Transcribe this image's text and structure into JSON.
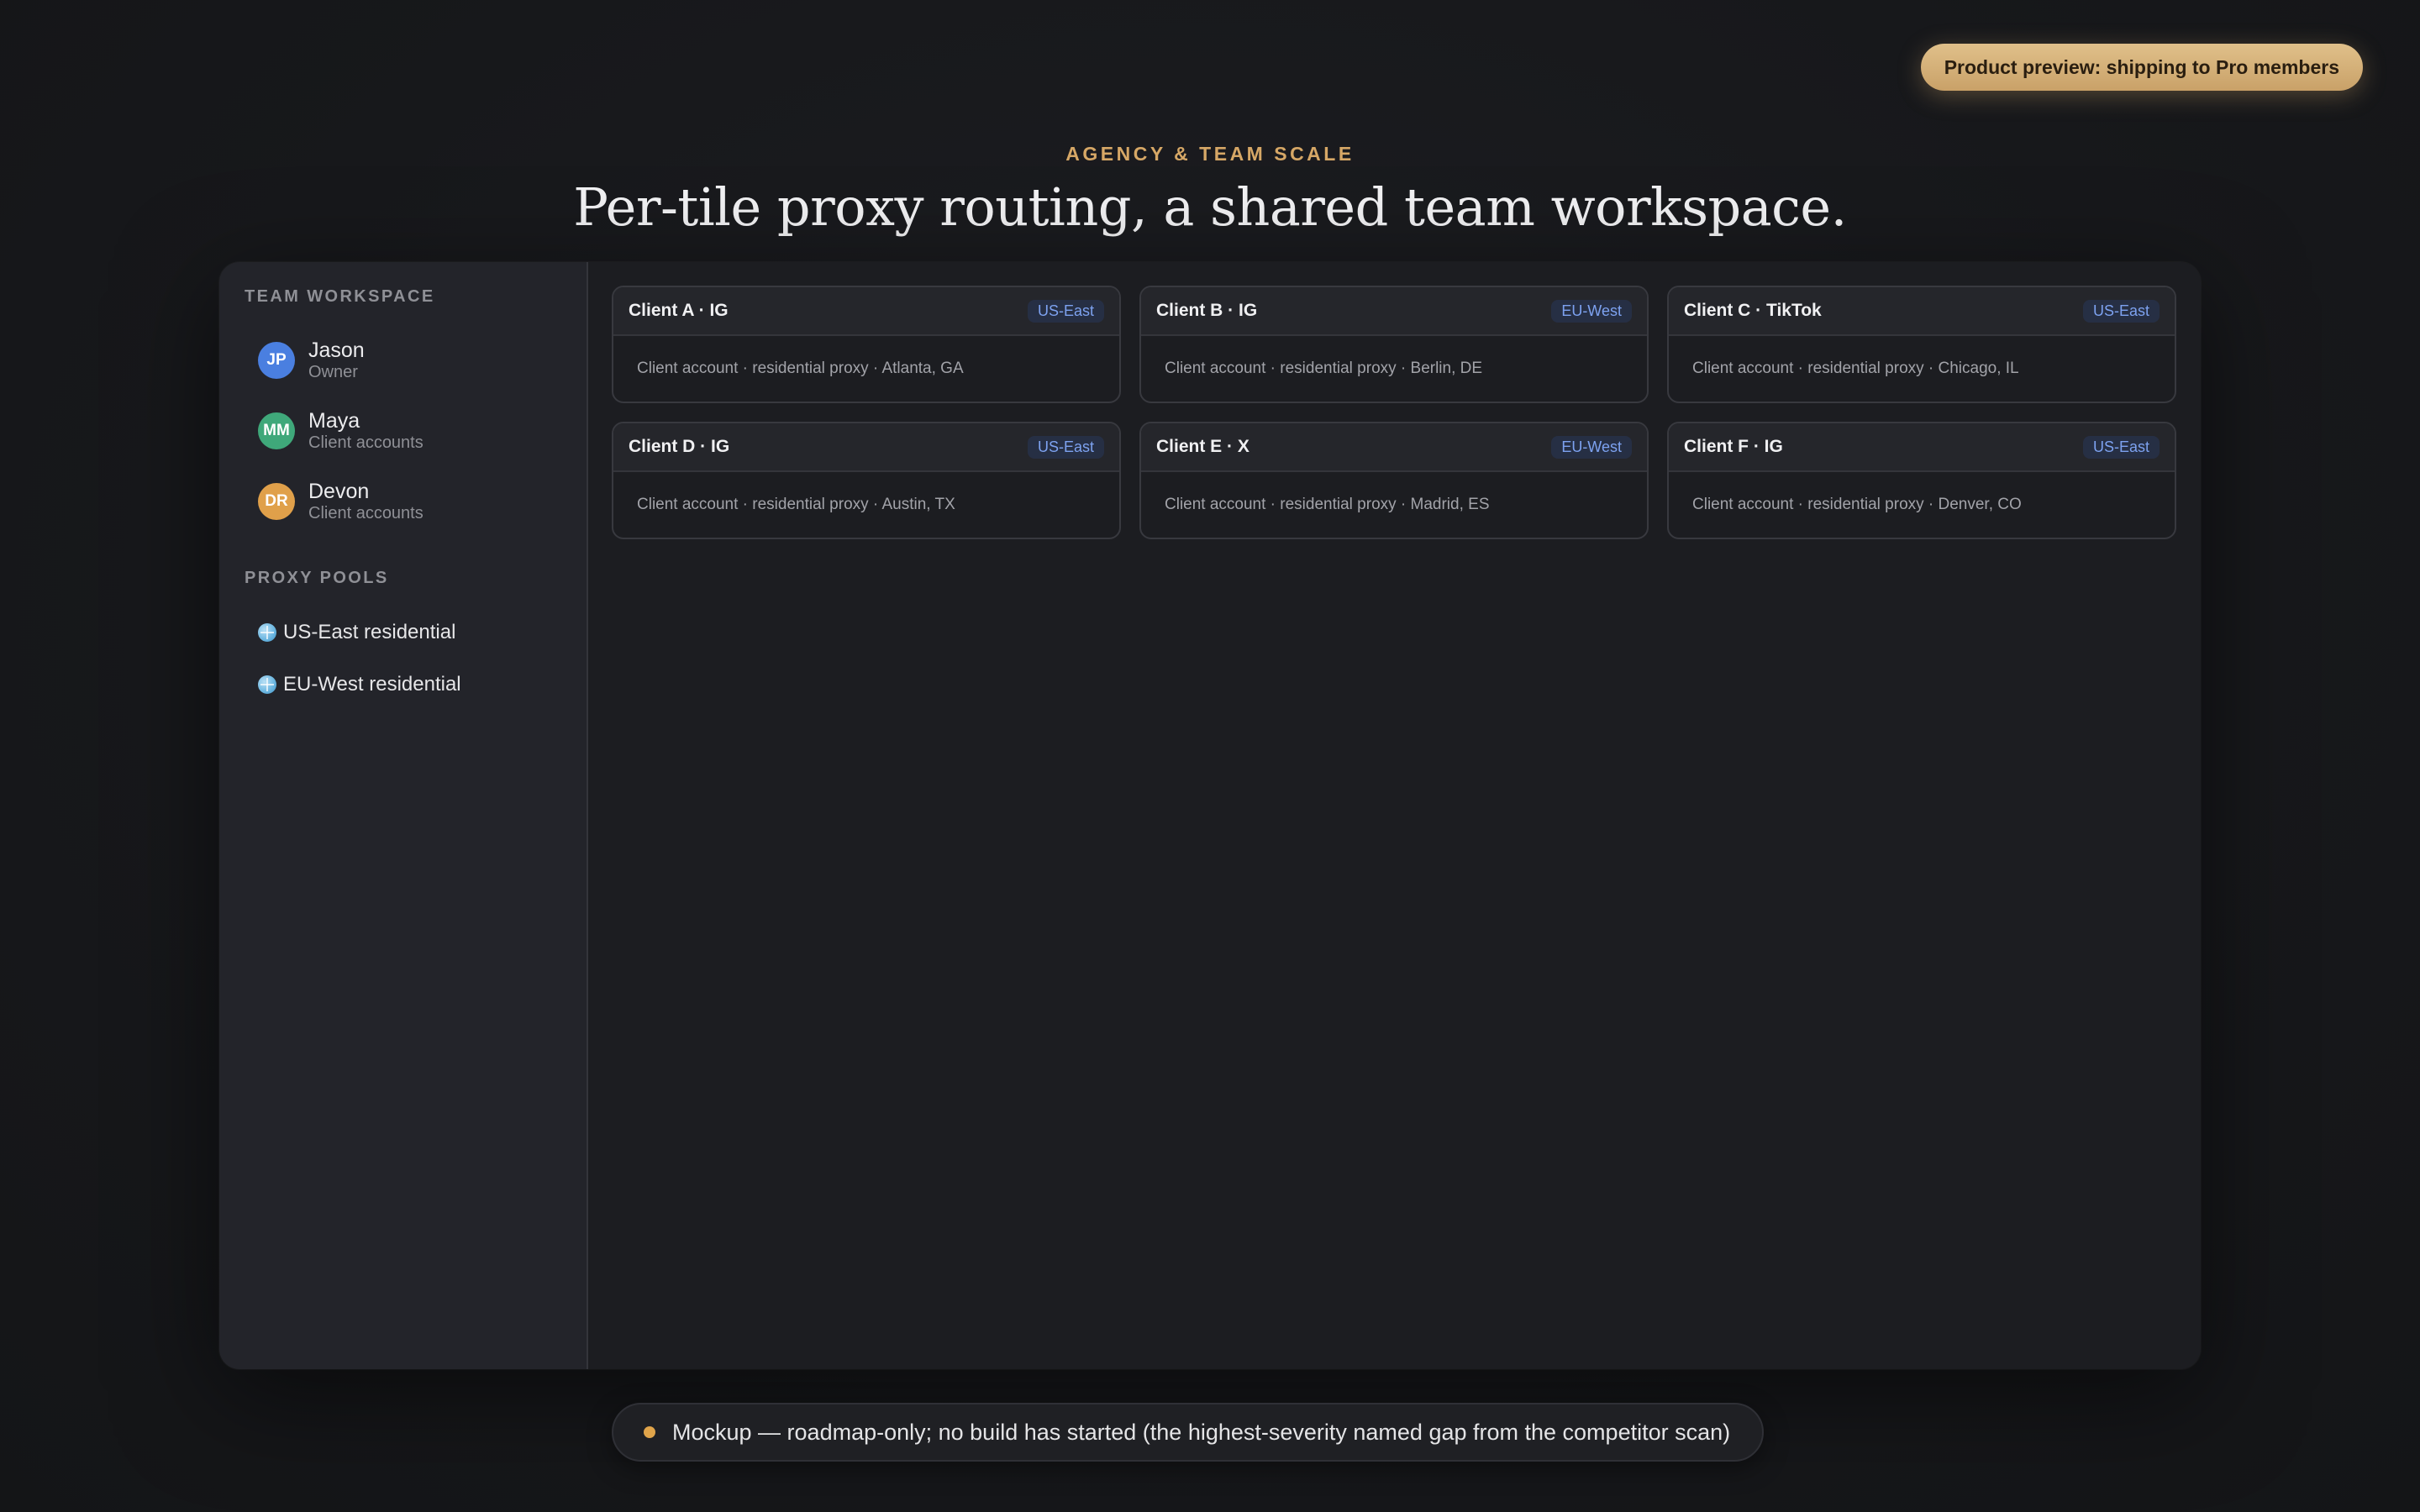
{
  "preview_badge": "Product preview: shipping to Pro members",
  "eyebrow": "AGENCY & TEAM SCALE",
  "headline": "Per-tile proxy routing, a shared team workspace.",
  "sidebar": {
    "team_title": "TEAM WORKSPACE",
    "members": [
      {
        "initials": "JP",
        "name": "Jason",
        "role": "Owner",
        "color": "#4a7fe0"
      },
      {
        "initials": "MM",
        "name": "Maya",
        "role": "Client accounts",
        "color": "#3fa87a"
      },
      {
        "initials": "DR",
        "name": "Devon",
        "role": "Client accounts",
        "color": "#e0a04a"
      }
    ],
    "pools_title": "PROXY POOLS",
    "pools": [
      {
        "icon": "globe-icon",
        "label": "US-East residential"
      },
      {
        "icon": "globe-icon",
        "label": "EU-West residential"
      }
    ]
  },
  "tiles": [
    {
      "title": "Client A · IG",
      "region": "US-East",
      "desc": "Client account · residential proxy · Atlanta, GA"
    },
    {
      "title": "Client B · IG",
      "region": "EU-West",
      "desc": "Client account · residential proxy · Berlin, DE"
    },
    {
      "title": "Client C · TikTok",
      "region": "US-East",
      "desc": "Client account · residential proxy · Chicago, IL"
    },
    {
      "title": "Client D · IG",
      "region": "US-East",
      "desc": "Client account · residential proxy · Austin, TX"
    },
    {
      "title": "Client E · X",
      "region": "EU-West",
      "desc": "Client account · residential proxy · Madrid, ES"
    },
    {
      "title": "Client F · IG",
      "region": "US-East",
      "desc": "Client account · residential proxy · Denver, CO"
    }
  ],
  "footnote": "Mockup — roadmap-only; no build has started (the highest-severity named gap from the competitor scan)",
  "colors": {
    "accent_gold": "#d6a766",
    "badge_text": "#7da2f0",
    "status_dot": "#e0a44a"
  }
}
